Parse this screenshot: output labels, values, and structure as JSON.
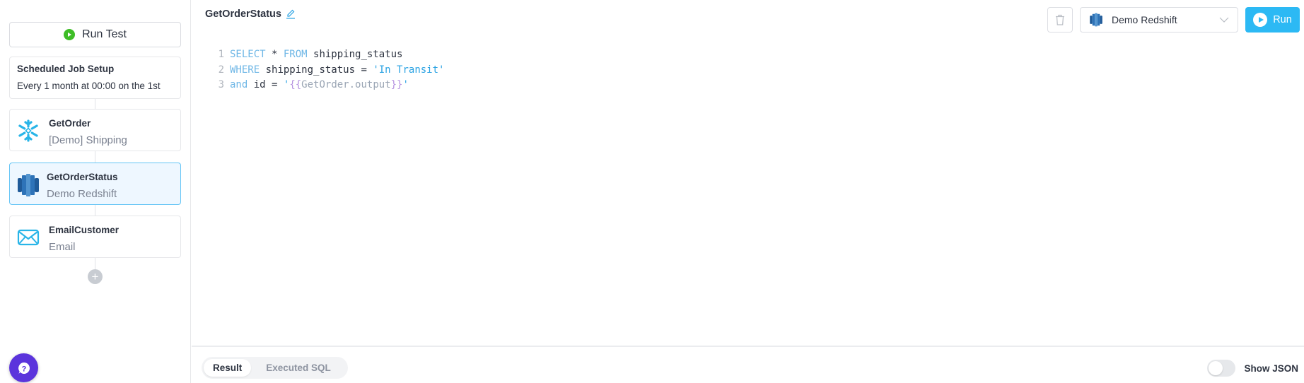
{
  "sidebar": {
    "run_test_label": "Run Test",
    "schedule": {
      "title": "Scheduled Job Setup",
      "subtitle": "Every 1 month at 00:00 on the 1st"
    },
    "steps": [
      {
        "name": "GetOrder",
        "source": "[Demo] Shipping",
        "icon": "snowflake-icon",
        "active": false
      },
      {
        "name": "GetOrderStatus",
        "source": "Demo Redshift",
        "icon": "redshift-icon",
        "active": true
      },
      {
        "name": "EmailCustomer",
        "source": "Email",
        "icon": "envelope-icon",
        "active": false
      }
    ],
    "add_step_label": "+",
    "help_label": "?"
  },
  "main": {
    "title": "GetOrderStatus",
    "toolbar": {
      "datasource": "Demo Redshift",
      "run_label": "Run"
    },
    "code": {
      "line_numbers": [
        "1",
        "2",
        "3"
      ],
      "line1": {
        "kw1": "SELECT",
        "star": " * ",
        "kw2": "FROM",
        "rest": " shipping_status"
      },
      "line2": {
        "kw": "WHERE",
        "rest": " shipping_status = ",
        "str": "'In Transit'"
      },
      "line3": {
        "kw": "and",
        "rest": " id = ",
        "q1": "'",
        "open": "{{",
        "var1": "GetOrder",
        "dot": ".output",
        "close": "}}",
        "q2": "'"
      }
    },
    "bottom": {
      "tabs": [
        "Result",
        "Executed SQL"
      ],
      "active_tab": "Result",
      "toggle_label": "Show JSON",
      "toggle_on": false
    }
  },
  "colors": {
    "accent": "#2cb9f4",
    "run_test_green": "#3ebd27",
    "help_purple": "#5b34dc",
    "active_card_bg": "#eef7ff",
    "active_card_border": "#63c4f5"
  }
}
